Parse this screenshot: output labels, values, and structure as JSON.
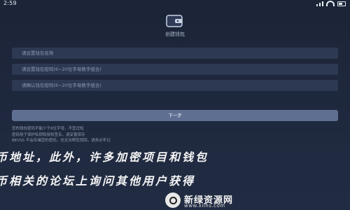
{
  "status_bar": {
    "time": "2:59"
  },
  "page": {
    "title": "创建钱包"
  },
  "form": {
    "wallet_name_placeholder": "请设置钱包名称",
    "password_placeholder": "请设置钱包密码(6~20位字母数字组合)",
    "confirm_password_placeholder": "请确认钱包密码(6~20位字母数字组合)"
  },
  "next_button_label": "下一步",
  "hint_lines": [
    "您的钱包密码不能少于6位字母，不宜过短",
    "密码用于保护私钥和授权签名，请妥善保存",
    "BEVSS 不会存储您的密码，也无法帮您找回，请务必牢记"
  ],
  "overlay_text": {
    "line1": "币地址，此外，许多加密项目和钱包",
    "line2": "币相关的论坛上询问其他用户获得"
  },
  "watermark": {
    "name": "新绿资源网",
    "url": "www.xilhs.com"
  },
  "colors": {
    "background": "#1f2a40",
    "field": "#2d3952",
    "button": "#5f6f91"
  }
}
